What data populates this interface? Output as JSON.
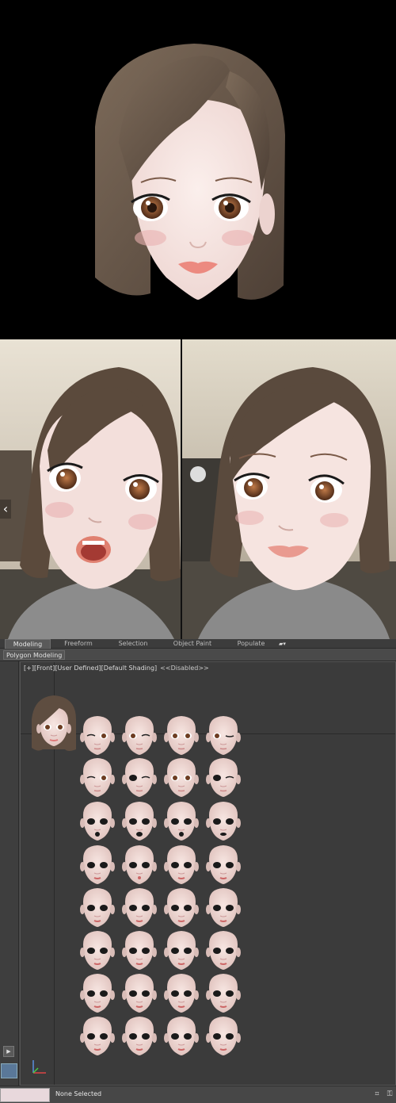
{
  "ribbon": {
    "tabs": [
      {
        "label": "Modeling",
        "active": true
      },
      {
        "label": "Freeform",
        "active": false
      },
      {
        "label": "Selection",
        "active": false
      },
      {
        "label": "Object Paint",
        "active": false
      },
      {
        "label": "Populate",
        "active": false
      }
    ],
    "extra_icon": "settings-dropdown-icon",
    "panel_label": "Polygon Modeling"
  },
  "viewport": {
    "plus": "[+]",
    "view": "[Front]",
    "mode": "[User Defined]",
    "shading": "[Default Shading]",
    "disabled": "<<Disabled>>"
  },
  "status": {
    "selection": "None Selected"
  },
  "colors": {
    "hair": "#6b5a4b",
    "skin": "#f5e2de",
    "iris": "#8a5230",
    "blush": "#eab0b0",
    "ui_panel": "#444444",
    "viewport_bg": "#3b3b3b"
  },
  "icons": [
    "back-arrow-icon",
    "play-icon",
    "axis-gizmo-icon",
    "maximize-icon",
    "key-icon"
  ]
}
